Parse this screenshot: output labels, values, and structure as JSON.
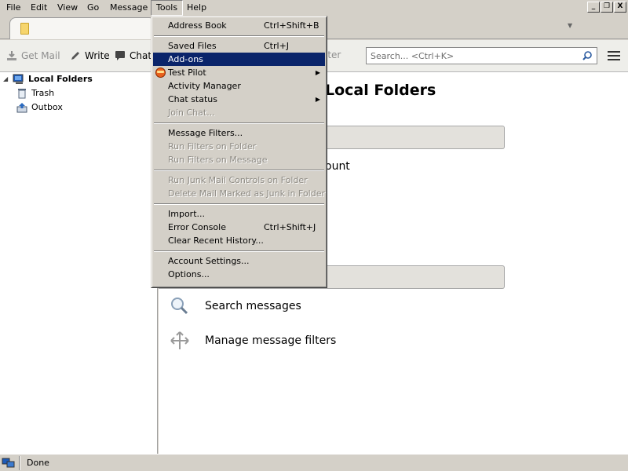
{
  "menubar": {
    "items": [
      {
        "label": "File"
      },
      {
        "label": "Edit"
      },
      {
        "label": "View"
      },
      {
        "label": "Go"
      },
      {
        "label": "Message"
      },
      {
        "label": "Tools"
      },
      {
        "label": "Help"
      }
    ],
    "open_menu": "Tools"
  },
  "window_controls": {
    "minimize": "_",
    "restore": "❐",
    "close": "X"
  },
  "tabs": {
    "home_icon": "folder-icon",
    "list_icon": "▼"
  },
  "toolbar": {
    "get_mail": "Get Mail",
    "write": "Write",
    "chat": "Chat",
    "filter_stub": "lter",
    "search_placeholder": "Search... <Ctrl+K>"
  },
  "folders": {
    "root": "Local Folders",
    "items": [
      "Trash",
      "Outbox"
    ]
  },
  "content": {
    "title_partial": "Local Folders",
    "account_text_partial": "ount",
    "actions": [
      "Search messages",
      "Manage message filters"
    ]
  },
  "tools_menu": {
    "groups": [
      [
        {
          "label": "Address Book",
          "shortcut": "Ctrl+Shift+B",
          "enabled": true
        }
      ],
      [
        {
          "label": "Saved Files",
          "shortcut": "Ctrl+J",
          "enabled": true
        },
        {
          "label": "Add-ons",
          "shortcut": "",
          "enabled": true,
          "highlighted": true
        },
        {
          "label": "Test Pilot",
          "shortcut": "",
          "enabled": true,
          "submenu": true,
          "icon": "test-pilot-icon"
        },
        {
          "label": "Activity Manager",
          "shortcut": "",
          "enabled": true
        },
        {
          "label": "Chat status",
          "shortcut": "",
          "enabled": true,
          "submenu": true
        },
        {
          "label": "Join Chat...",
          "shortcut": "",
          "enabled": false
        }
      ],
      [
        {
          "label": "Message Filters...",
          "shortcut": "",
          "enabled": true
        },
        {
          "label": "Run Filters on Folder",
          "shortcut": "",
          "enabled": false
        },
        {
          "label": "Run Filters on Message",
          "shortcut": "",
          "enabled": false
        }
      ],
      [
        {
          "label": "Run Junk Mail Controls on Folder",
          "shortcut": "",
          "enabled": false
        },
        {
          "label": "Delete Mail Marked as Junk in Folder",
          "shortcut": "",
          "enabled": false
        }
      ],
      [
        {
          "label": "Import...",
          "shortcut": "",
          "enabled": true
        },
        {
          "label": "Error Console",
          "shortcut": "Ctrl+Shift+J",
          "enabled": true
        },
        {
          "label": "Clear Recent History...",
          "shortcut": "",
          "enabled": true
        }
      ],
      [
        {
          "label": "Account Settings...",
          "shortcut": "",
          "enabled": true
        },
        {
          "label": "Options...",
          "shortcut": "",
          "enabled": true
        }
      ]
    ]
  },
  "statusbar": {
    "text": "Done"
  },
  "colors": {
    "highlight": "#0a246a",
    "chrome": "#d4d0c8",
    "section_bar": "#e3e1dc"
  }
}
